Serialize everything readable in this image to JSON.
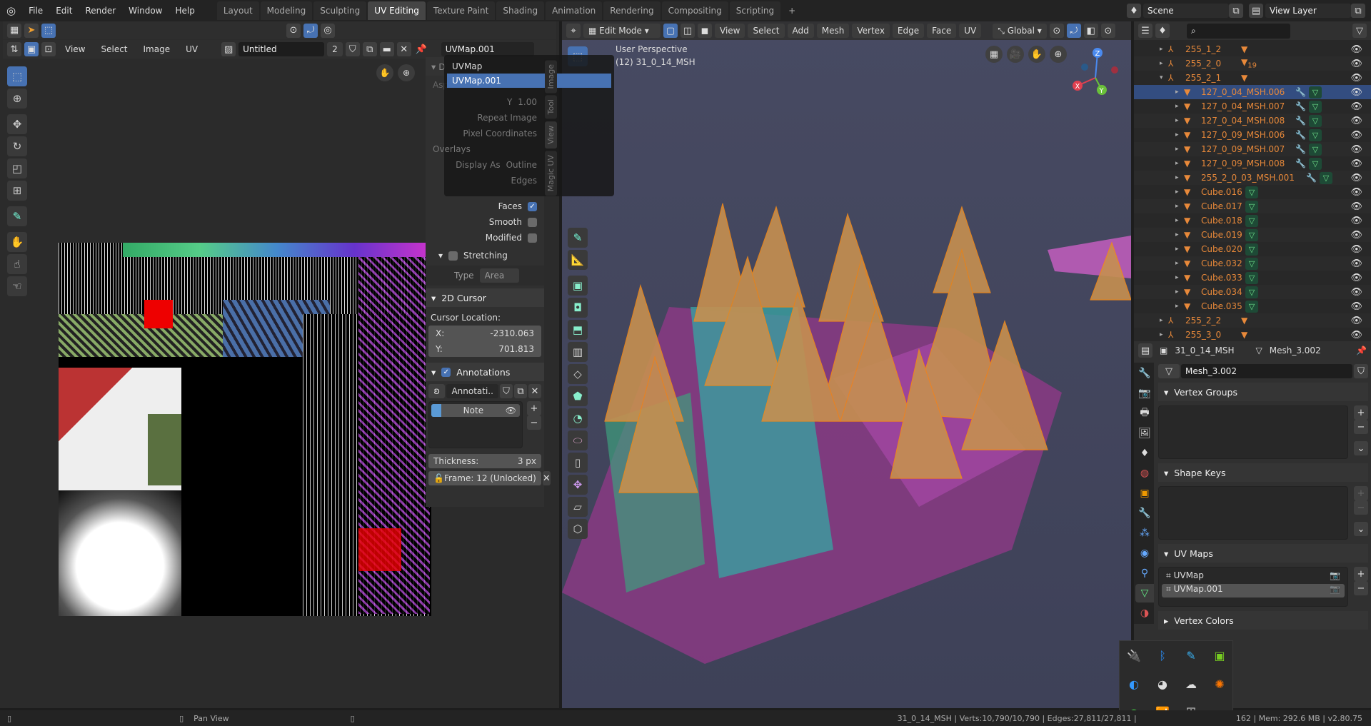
{
  "topbar": {
    "menus": [
      "File",
      "Edit",
      "Render",
      "Window",
      "Help"
    ],
    "workspaces": [
      "Layout",
      "Modeling",
      "Sculpting",
      "UV Editing",
      "Texture Paint",
      "Shading",
      "Animation",
      "Rendering",
      "Compositing",
      "Scripting",
      "+"
    ],
    "active_workspace": "UV Editing",
    "scene": "Scene",
    "view_layer": "View Layer"
  },
  "uv_editor": {
    "menus": [
      "View",
      "Select",
      "Image",
      "UV"
    ],
    "image_name": "Untitled",
    "users": "2",
    "uvmap_field": "UVMap.001",
    "dropdown": {
      "items": [
        "UVMap",
        "UVMap.001"
      ],
      "selected": "UVMap.001"
    },
    "sidebar": {
      "faint": {
        "aspect": "Asp",
        "y_label": "Y",
        "y_value": "1.00",
        "repeat": "Repeat Image",
        "pixel": "Pixel Coordinates",
        "overlays": "Overlays",
        "display_as": "Display As",
        "display_val": "Outline",
        "edges": "Edges",
        "tabs": [
          "Image",
          "Tool",
          "View",
          "Magic UV"
        ]
      },
      "faces": "Faces",
      "smooth": "Smooth",
      "modified": "Modified",
      "stretching": "Stretching",
      "type_label": "Type",
      "type_value": "Area",
      "cursor_header": "2D Cursor",
      "cursor_location": "Cursor Location:",
      "x_label": "X:",
      "x_value": "-2310.063",
      "y_label": "Y:",
      "y_value": "701.813",
      "annotations": "Annotations",
      "annot_name": "Annotati..",
      "layer": "Note",
      "thickness_label": "Thickness:",
      "thickness_value": "3 px",
      "frame": "Frame: 12 (Unlocked)"
    }
  },
  "viewport": {
    "mode": "Edit Mode",
    "menus": [
      "View",
      "Select",
      "Add",
      "Mesh",
      "Vertex",
      "Edge",
      "Face",
      "UV"
    ],
    "orientation": "Global",
    "title": "User Perspective",
    "object": "(12) 31_0_14_MSH",
    "gizmo": {
      "x": "X",
      "y": "Y",
      "z": "Z"
    },
    "colors": {
      "bg": "#4a4d66",
      "orange": "#f08a1c"
    }
  },
  "outliner": {
    "items": [
      {
        "name": "255_1_2",
        "type": "empty",
        "level": 0
      },
      {
        "name": "255_2_0",
        "type": "empty",
        "level": 0,
        "badge": "19"
      },
      {
        "name": "255_2_1",
        "type": "empty",
        "level": 0,
        "open": true
      },
      {
        "name": "127_0_04_MSH.006",
        "type": "mesh",
        "level": 1,
        "mod": true,
        "selected": true
      },
      {
        "name": "127_0_04_MSH.007",
        "type": "mesh",
        "level": 1,
        "mod": true
      },
      {
        "name": "127_0_04_MSH.008",
        "type": "mesh",
        "level": 1,
        "mod": true
      },
      {
        "name": "127_0_09_MSH.006",
        "type": "mesh",
        "level": 1,
        "mod": true
      },
      {
        "name": "127_0_09_MSH.007",
        "type": "mesh",
        "level": 1,
        "mod": true
      },
      {
        "name": "127_0_09_MSH.008",
        "type": "mesh",
        "level": 1,
        "mod": true
      },
      {
        "name": "255_2_0_03_MSH.001",
        "type": "mesh",
        "level": 1,
        "mod": true
      },
      {
        "name": "Cube.016",
        "type": "mesh",
        "level": 1
      },
      {
        "name": "Cube.017",
        "type": "mesh",
        "level": 1
      },
      {
        "name": "Cube.018",
        "type": "mesh",
        "level": 1
      },
      {
        "name": "Cube.019",
        "type": "mesh",
        "level": 1
      },
      {
        "name": "Cube.020",
        "type": "mesh",
        "level": 1
      },
      {
        "name": "Cube.032",
        "type": "mesh",
        "level": 1
      },
      {
        "name": "Cube.033",
        "type": "mesh",
        "level": 1
      },
      {
        "name": "Cube.034",
        "type": "mesh",
        "level": 1
      },
      {
        "name": "Cube.035",
        "type": "mesh",
        "level": 1
      },
      {
        "name": "255_2_2",
        "type": "empty",
        "level": 0
      },
      {
        "name": "255_3_0",
        "type": "empty",
        "level": 0
      }
    ]
  },
  "properties": {
    "object": "31_0_14_MSH",
    "mesh": "Mesh_3.002",
    "datablock": "Mesh_3.002",
    "vertex_groups": "Vertex Groups",
    "shape_keys": "Shape Keys",
    "uv_maps": "UV Maps",
    "uv_list": [
      "UVMap",
      "UVMap.001"
    ],
    "vertex_colors": "Vertex Colors"
  },
  "statusbar": {
    "pan": "Pan View",
    "stats_left": "31_0_14_MSH | Verts:10,790/10,790 | Edges:27,811/27,811 |",
    "stats_right": "162 | Mem: 292.6 MB | v2.80.75"
  }
}
